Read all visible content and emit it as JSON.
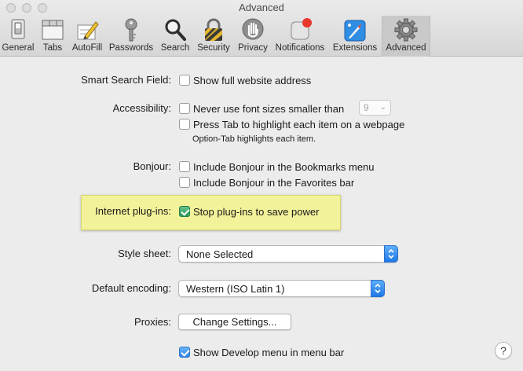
{
  "window": {
    "title": "Advanced"
  },
  "toolbar": {
    "tabs": [
      {
        "label": "General",
        "icon": "general-switch-icon"
      },
      {
        "label": "Tabs",
        "icon": "tabs-window-icon"
      },
      {
        "label": "AutoFill",
        "icon": "autofill-pencil-icon"
      },
      {
        "label": "Passwords",
        "icon": "key-icon"
      },
      {
        "label": "Search",
        "icon": "magnifier-icon"
      },
      {
        "label": "Security",
        "icon": "padlock-icon"
      },
      {
        "label": "Privacy",
        "icon": "hand-icon"
      },
      {
        "label": "Notifications",
        "icon": "notification-badge-icon"
      },
      {
        "label": "Extensions",
        "icon": "extensions-icon"
      },
      {
        "label": "Advanced",
        "icon": "gear-icon",
        "selected": true
      }
    ]
  },
  "settings": {
    "smart_search": {
      "label": "Smart Search Field:",
      "option": "Show full website address",
      "checked": false
    },
    "accessibility": {
      "label": "Accessibility:",
      "min_font": {
        "option": "Never use font sizes smaller than",
        "checked": false,
        "value": "9"
      },
      "tab_highlight": {
        "option": "Press Tab to highlight each item on a webpage",
        "checked": false
      },
      "hint": "Option-Tab highlights each item."
    },
    "bonjour": {
      "label": "Bonjour:",
      "bookmarks": {
        "option": "Include Bonjour in the Bookmarks menu",
        "checked": false
      },
      "favorites": {
        "option": "Include Bonjour in the Favorites bar",
        "checked": false
      }
    },
    "plugins": {
      "label": "Internet plug-ins:",
      "option": "Stop plug-ins to save power",
      "checked": true
    },
    "style_sheet": {
      "label": "Style sheet:",
      "value": "None Selected"
    },
    "encoding": {
      "label": "Default encoding:",
      "value": "Western (ISO Latin 1)"
    },
    "proxies": {
      "label": "Proxies:",
      "button": "Change Settings..."
    },
    "develop": {
      "option": "Show Develop menu in menu bar",
      "checked": true
    }
  },
  "help": {
    "glyph": "?"
  },
  "colors": {
    "highlight": "#f2f29a",
    "accent": "#2f86e8",
    "checked_green": "#2d9a5c"
  }
}
